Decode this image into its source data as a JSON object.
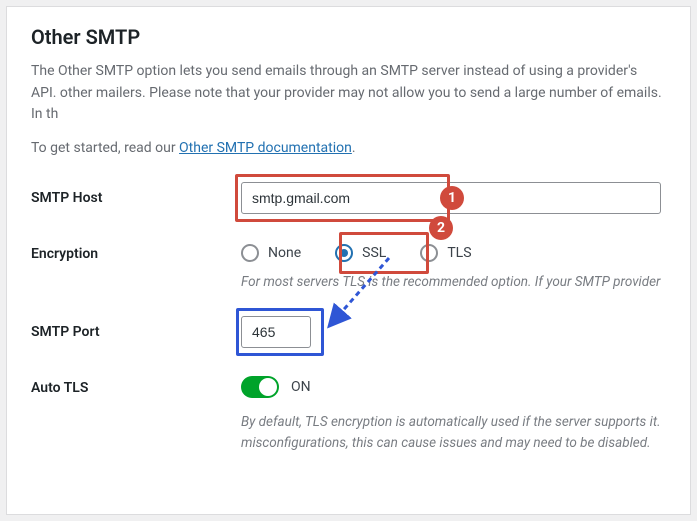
{
  "title": "Other SMTP",
  "description": "The Other SMTP option lets you send emails through an SMTP server instead of using a provider's API. other mailers. Please note that your provider may not allow you to send a large number of emails. In th",
  "getstarted_prefix": "To get started, read our ",
  "doc_link_text": "Other SMTP documentation",
  "getstarted_suffix": ".",
  "fields": {
    "smtp_host": {
      "label": "SMTP Host",
      "value": "smtp.gmail.com"
    },
    "encryption": {
      "label": "Encryption",
      "options": {
        "none": "None",
        "ssl": "SSL",
        "tls": "TLS"
      },
      "selected": "ssl",
      "hint": "For most servers TLS is the recommended option. If your SMTP provider"
    },
    "smtp_port": {
      "label": "SMTP Port",
      "value": "465"
    },
    "auto_tls": {
      "label": "Auto TLS",
      "state_text": "ON",
      "hint": "By default, TLS encryption is automatically used if the server supports it. misconfigurations, this can cause issues and may need to be disabled."
    }
  },
  "annotations": {
    "badge1": "1",
    "badge2": "2"
  }
}
